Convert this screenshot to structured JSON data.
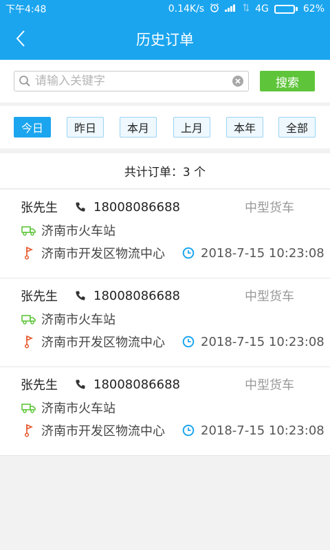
{
  "status_bar": {
    "time": "下午4:48",
    "speed": "0.14K/s",
    "network": "4G",
    "battery": "62%",
    "battery_level": 0.62
  },
  "header": {
    "title": "历史订单"
  },
  "search": {
    "placeholder": "请输入关键字",
    "value": "",
    "button_label": "搜索"
  },
  "filters": [
    {
      "label": "今日",
      "active": true
    },
    {
      "label": "昨日",
      "active": false
    },
    {
      "label": "本月",
      "active": false
    },
    {
      "label": "上月",
      "active": false
    },
    {
      "label": "本年",
      "active": false
    },
    {
      "label": "全部",
      "active": false
    }
  ],
  "summary": {
    "text": "共计订单：3 个"
  },
  "orders": [
    {
      "name": "张先生",
      "phone": "18008086688",
      "vehicle": "中型货车",
      "from": "济南市火车站",
      "to": "济南市开发区物流中心",
      "time": "2018-7-15 10:23:08"
    },
    {
      "name": "张先生",
      "phone": "18008086688",
      "vehicle": "中型货车",
      "from": "济南市火车站",
      "to": "济南市开发区物流中心",
      "time": "2018-7-15 10:23:08"
    },
    {
      "name": "张先生",
      "phone": "18008086688",
      "vehicle": "中型货车",
      "from": "济南市火车站",
      "to": "济南市开发区物流中心",
      "time": "2018-7-15 10:23:08"
    }
  ],
  "colors": {
    "primary": "#1ba5ef",
    "search_button": "#5ec53a",
    "truck_icon": "#5ec53a",
    "flag_icon": "#e5562a",
    "clock_icon": "#1ba5ef"
  },
  "icons": [
    "back-icon",
    "signal-icon",
    "alarm-icon",
    "battery-icon",
    "search-icon",
    "clear-icon",
    "phone-icon",
    "truck-icon",
    "flag-icon",
    "clock-icon"
  ]
}
